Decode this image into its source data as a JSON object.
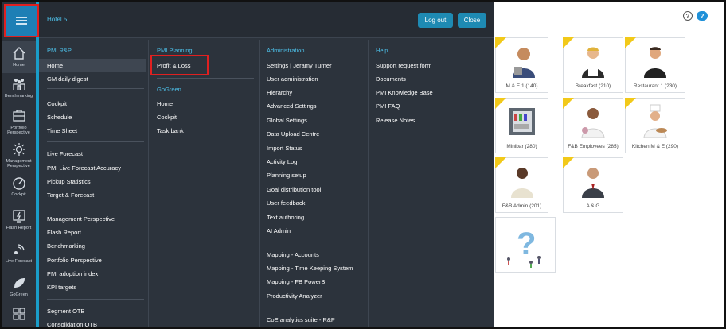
{
  "header": {
    "hotel_name": "Hotel 5",
    "logout_label": "Log out",
    "close_label": "Close"
  },
  "rail": {
    "items": [
      {
        "label": "Home",
        "icon": "home-icon"
      },
      {
        "label": "Benchmarking",
        "icon": "benchmarking-icon"
      },
      {
        "label": "Portfolio Perspective",
        "icon": "portfolio-icon"
      },
      {
        "label": "Management Perspective",
        "icon": "sun-icon"
      },
      {
        "label": "Cockpit",
        "icon": "gauge-icon"
      },
      {
        "label": "Flash Report",
        "icon": "flash-icon"
      },
      {
        "label": "Live Forecast",
        "icon": "signal-icon"
      },
      {
        "label": "GoGreen",
        "icon": "leaf-icon"
      },
      {
        "label": "",
        "icon": "grid-icon"
      }
    ]
  },
  "menu": {
    "pmi_rp": {
      "heading": "PMI R&P",
      "items": [
        "Home",
        "GM daily digest",
        "Cockpit",
        "Schedule",
        "Time Sheet",
        "Live Forecast",
        "PMI Live Forecast Accuracy",
        "Pickup Statistics",
        "Target & Forecast",
        "Management Perspective",
        "Flash Report",
        "Benchmarking",
        "Portfolio Perspective",
        "PMI adoption index",
        "KPI targets",
        "Segment OTB",
        "Consolidation OTB"
      ]
    },
    "pmi_planning": {
      "heading": "PMI Planning",
      "items": [
        "Profit & Loss"
      ]
    },
    "gogreen": {
      "heading": "GoGreen",
      "items": [
        "Home",
        "Cockpit",
        "Task bank"
      ]
    },
    "administration": {
      "heading": "Administration",
      "items": [
        "Settings | Jeramy Turner",
        "User administration",
        "Hierarchy",
        "Advanced Settings",
        "Global Settings",
        "Data Upload Centre",
        "Import Status",
        "Activity Log",
        "Planning setup",
        "Goal distribution tool",
        "User feedback",
        "Text authoring",
        "AI Admin",
        "Mapping - Accounts",
        "Mapping - Time Keeping System",
        "Mapping - FB PowerBI",
        "Productivity Analyzer",
        "CoE analytics suite - R&P"
      ]
    },
    "help": {
      "heading": "Help",
      "items": [
        "Support request form",
        "Documents",
        "PMI Knowledge Base",
        "PMI FAQ",
        "Release Notes"
      ]
    }
  },
  "cards": [
    {
      "label": "M & E 1 (140)"
    },
    {
      "label": "Breakfast (210)"
    },
    {
      "label": "Restaurant 1 (230)"
    },
    {
      "label": "Minibar (280)"
    },
    {
      "label": "F&B Employees (285)"
    },
    {
      "label": "Kitchen M & E (290)"
    },
    {
      "label": "F&B Admin (201)"
    },
    {
      "label": "A & G"
    }
  ],
  "top_right": {
    "help_icon": "question-circle-icon",
    "chat_icon": "chat-bubble-icon",
    "help_glyph": "?",
    "chat_glyph": "?"
  },
  "colors": {
    "panel": "#2c333c",
    "accent": "#4dc1ea",
    "button": "#1e8ab3",
    "highlight_box": "#e02020",
    "card_tag": "#f2c919"
  }
}
